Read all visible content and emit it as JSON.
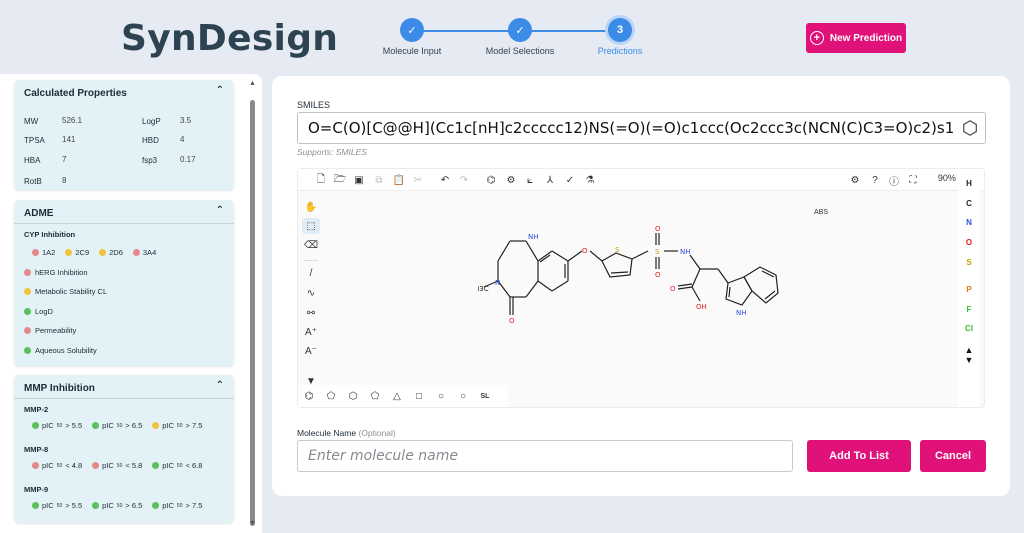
{
  "app": {
    "title": "SynDesign"
  },
  "stepper": {
    "steps": [
      {
        "label": "Molecule Input",
        "mark": "✓"
      },
      {
        "label": "Model Selections",
        "mark": "✓"
      },
      {
        "label": "Predictions",
        "mark": "3"
      }
    ],
    "current_step": 3
  },
  "header": {
    "new_prediction_label": "New Prediction"
  },
  "sidebar": {
    "calculated_properties": {
      "title": "Calculated Properties",
      "props": [
        {
          "name": "MW",
          "value": "526.1"
        },
        {
          "name": "LogP",
          "value": "3.5"
        },
        {
          "name": "TPSA",
          "value": "141"
        },
        {
          "name": "HBD",
          "value": "4"
        },
        {
          "name": "HBA",
          "value": "7"
        },
        {
          "name": "fsp3",
          "value": "0.17"
        },
        {
          "name": "RotB",
          "value": "8"
        }
      ]
    },
    "adme": {
      "title": "ADME",
      "cyp_label": "CYP Inhibition",
      "cyp": [
        {
          "name": "1A2",
          "color": "#e58a8a"
        },
        {
          "name": "2C9",
          "color": "#f0c33c"
        },
        {
          "name": "2D6",
          "color": "#f0c33c"
        },
        {
          "name": "3A4",
          "color": "#e58a8a"
        }
      ],
      "items": [
        {
          "label": "hERG Inhibition",
          "color": "#e58a8a"
        },
        {
          "label": "Metabolic Stability CL",
          "color": "#f0c33c"
        },
        {
          "label": "LogD",
          "color": "#5bbf5b"
        },
        {
          "label": "Permeability",
          "color": "#e58a8a"
        },
        {
          "label": "Aqueous Solubility",
          "color": "#5bbf5b"
        }
      ]
    },
    "mmp": {
      "title": "MMP Inhibition",
      "groups": [
        {
          "name": "MMP-2",
          "items": [
            {
              "op": " > 5.5",
              "color": "#5bbf5b"
            },
            {
              "op": " > 6.5",
              "color": "#5bbf5b"
            },
            {
              "op": " > 7.5",
              "color": "#f0c33c"
            }
          ]
        },
        {
          "name": "MMP-8",
          "items": [
            {
              "op": " < 4.8",
              "color": "#e58a8a"
            },
            {
              "op": " < 5.8",
              "color": "#e58a8a"
            },
            {
              "op": " < 6.8",
              "color": "#5bbf5b"
            }
          ]
        },
        {
          "name": "MMP-9",
          "items": [
            {
              "op": " > 5.5",
              "color": "#5bbf5b"
            },
            {
              "op": " > 6.5",
              "color": "#5bbf5b"
            },
            {
              "op": " > 7.5",
              "color": "#5bbf5b"
            }
          ]
        }
      ]
    }
  },
  "smiles": {
    "label": "SMILES",
    "value": "O=C(O)[C@@H](Cc1c[nH]c2ccccc12)NS(=O)(=O)c1ccc(Oc2ccc3c(NCN(C)C3=O)c2)s1",
    "supports": "Supports: SMILES"
  },
  "editor": {
    "zoom": "90%",
    "abs_label": "ABS",
    "atoms": [
      "H",
      "C",
      "N",
      "O",
      "S",
      "P",
      "F",
      "Cl"
    ],
    "atom_colors": [
      "#222222",
      "#222222",
      "#2f4fe0",
      "#e02020",
      "#c8a000",
      "#e07a00",
      "#2fbf2f",
      "#2fbf2f"
    ],
    "molecule_labels": {
      "nh": "NH",
      "o_ring": "O",
      "n_ring": "N",
      "h3c": "H3C",
      "o_carbonyl": "O",
      "s_thio": "S",
      "s_sulf": "S",
      "o1": "O",
      "o2": "O",
      "nh_sulf": "NH",
      "o_acid": "O",
      "oh": "OH",
      "nh_indole": "NH"
    }
  },
  "molecule_name": {
    "label": "Molecule Name",
    "optional": "(Optional)",
    "placeholder": "Enter molecule name"
  },
  "actions": {
    "add_label": "Add To List",
    "cancel_label": "Cancel"
  }
}
